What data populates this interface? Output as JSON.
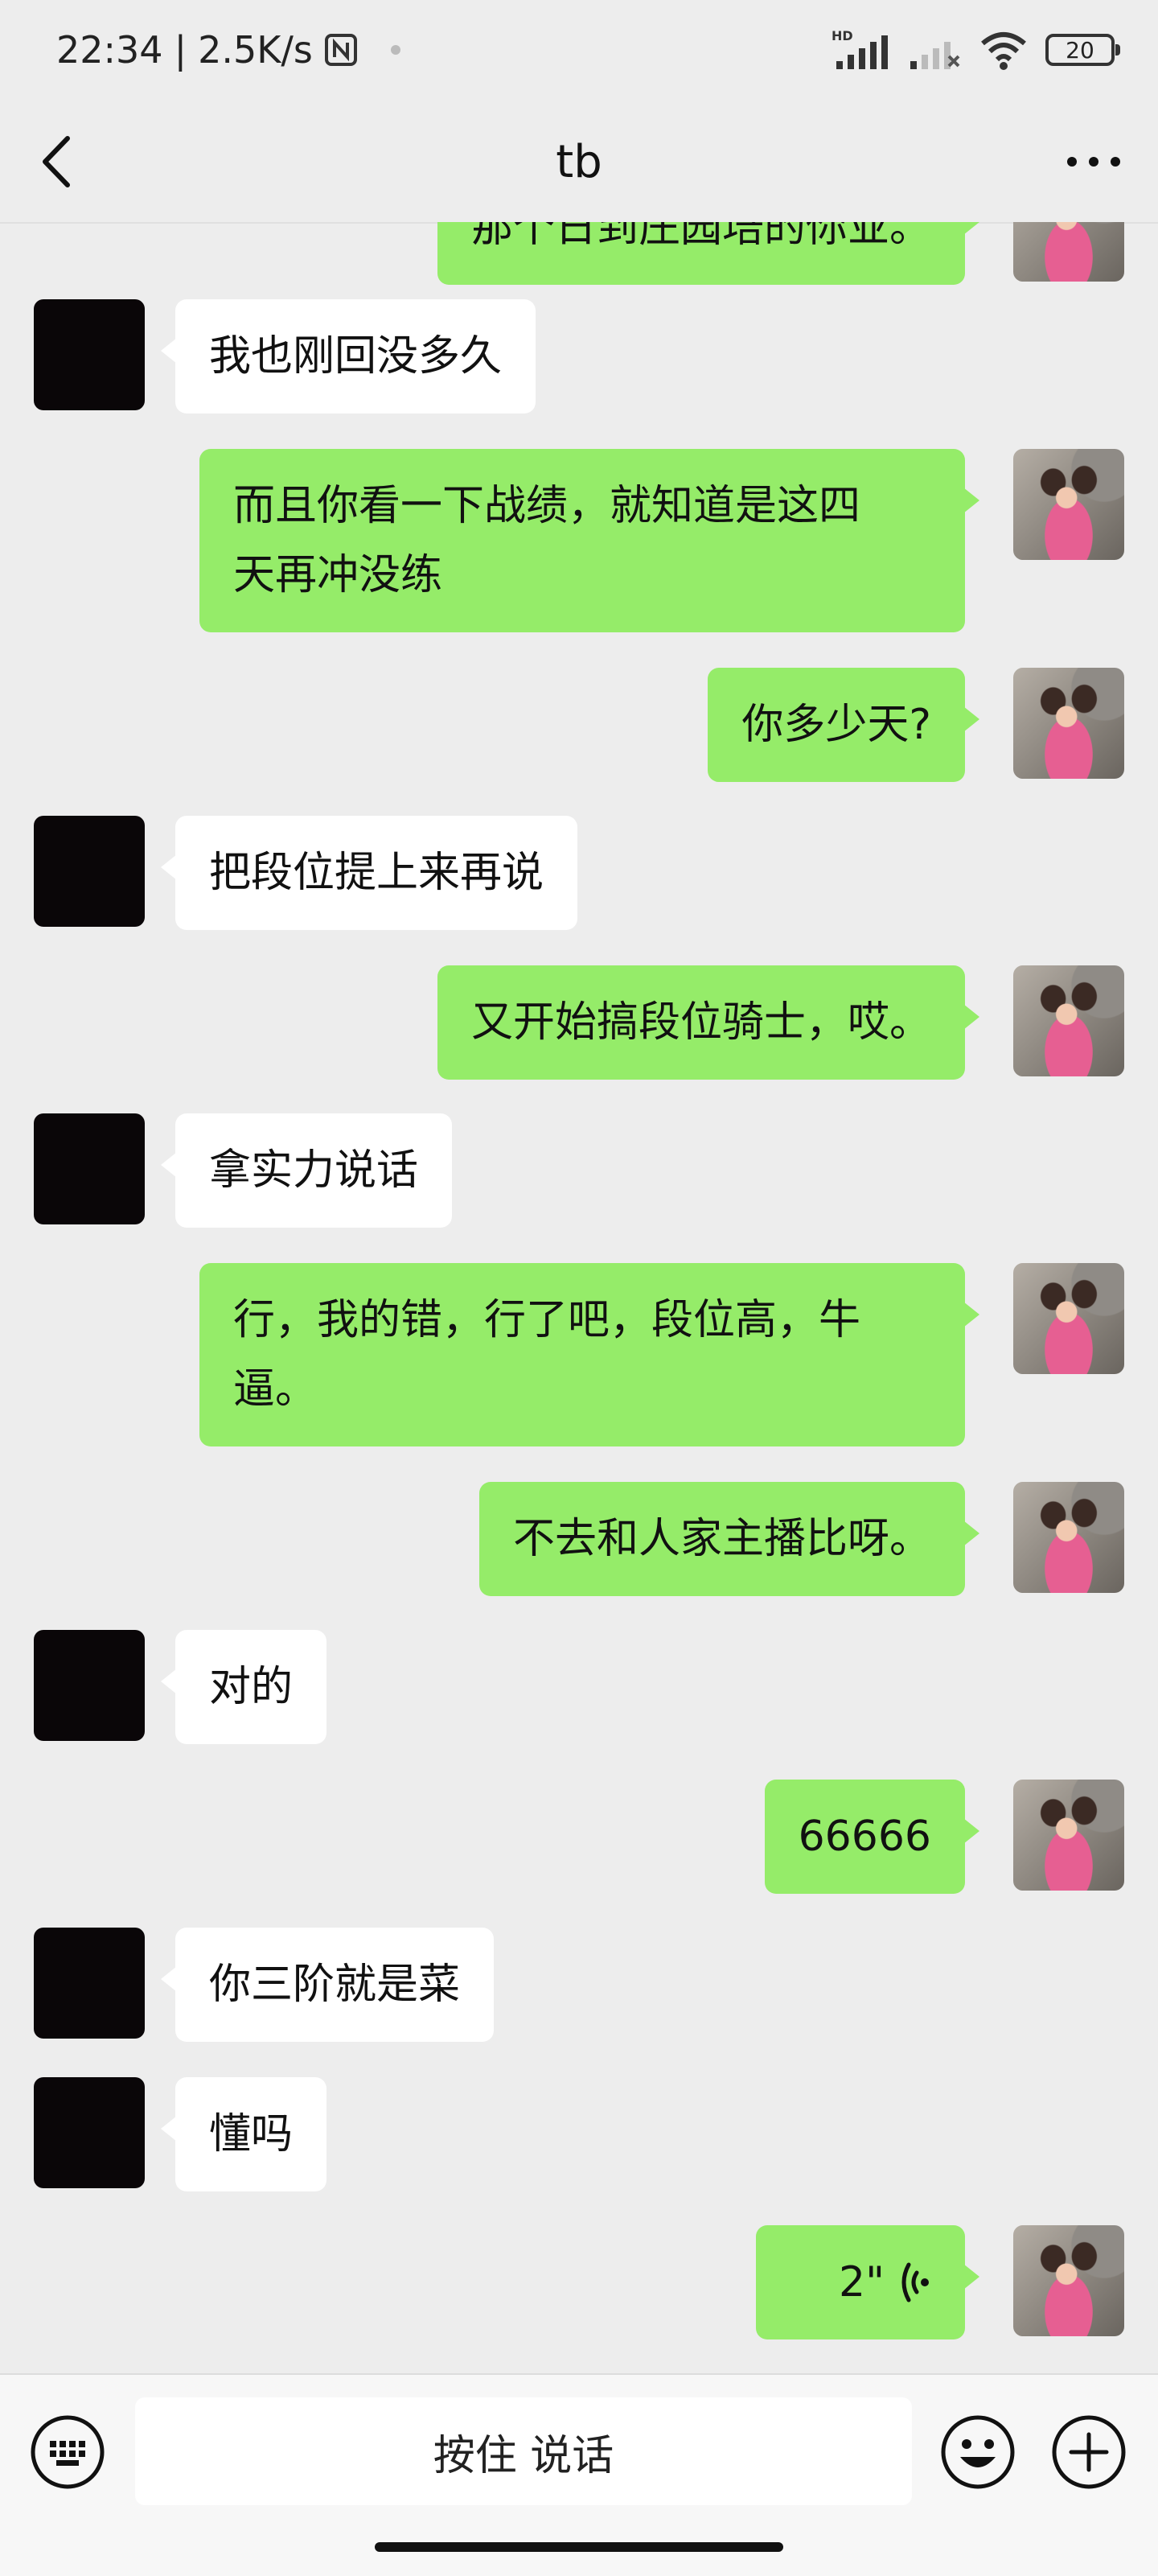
{
  "status_bar": {
    "time": "22:34",
    "separator": "|",
    "speed": "2.5K/s",
    "hd_label": "HD",
    "battery": "20"
  },
  "nav": {
    "title": "tb",
    "back_icon": "chevron-left-icon",
    "more_icon": "more-dots-icon"
  },
  "messages": [
    {
      "side": "right",
      "text": "那个日到庄园培的你业。"
    },
    {
      "side": "left",
      "text": "我也刚回没多久"
    },
    {
      "side": "right",
      "lines": [
        "而且你看一下战绩，就知道是这四",
        "天再冲没练"
      ]
    },
    {
      "side": "right",
      "text": "你多少天?"
    },
    {
      "side": "left",
      "text": "把段位提上来再说"
    },
    {
      "side": "right",
      "text": "又开始搞段位骑士，哎。"
    },
    {
      "side": "left",
      "text": "拿实力说话"
    },
    {
      "side": "right",
      "lines": [
        "行，我的错，行了吧，段位高，牛",
        "逼。"
      ]
    },
    {
      "side": "right",
      "text": "不去和人家主播比呀。"
    },
    {
      "side": "left",
      "text": "对的"
    },
    {
      "side": "right",
      "text": "66666"
    },
    {
      "side": "left",
      "text": "你三阶就是菜"
    },
    {
      "side": "left",
      "text": "懂吗"
    },
    {
      "side": "right",
      "type": "voice",
      "duration": "2\""
    }
  ],
  "input_bar": {
    "hold_to_talk_label": "按住 说话",
    "keyboard_icon": "keyboard-icon",
    "emoji_icon": "emoji-icon",
    "plus_icon": "plus-icon"
  },
  "colors": {
    "background": "#ededed",
    "outgoing_bubble": "#95ec69",
    "incoming_bubble": "#ffffff"
  }
}
